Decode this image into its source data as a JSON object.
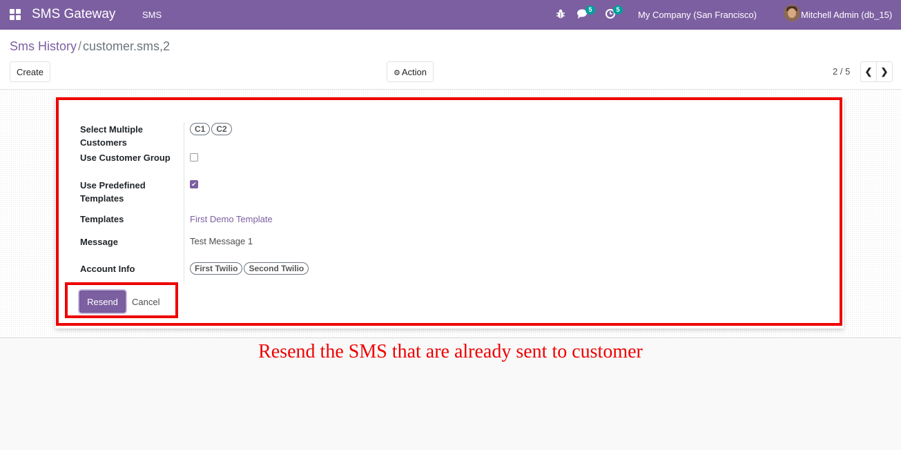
{
  "navbar": {
    "app_name": "SMS Gateway",
    "menu_item": "SMS",
    "chat_badge": "5",
    "activity_badge": "5",
    "company": "My Company (San Francisco)",
    "user": "Mitchell Admin (db_15)"
  },
  "control": {
    "breadcrumb_parent": "Sms History",
    "breadcrumb_separator": "/",
    "breadcrumb_current": "customer.sms,2",
    "create_label": "Create",
    "action_label": "Action",
    "pager": "2 / 5"
  },
  "form": {
    "fields": {
      "multiple_customers_label": "Select Multiple Customers",
      "customers": [
        "C1",
        "C2"
      ],
      "customer_group_label": "Use Customer Group",
      "customer_group_checked": false,
      "predefined_label": "Use Predefined Templates",
      "predefined_checked": true,
      "templates_label": "Templates",
      "template_value": "First Demo Template",
      "message_label": "Message",
      "message_value": "Test Message 1",
      "account_label": "Account Info",
      "accounts": [
        "First Twilio",
        "Second Twilio"
      ]
    },
    "resend_label": "Resend",
    "cancel_label": "Cancel"
  },
  "annotation": "Resend the SMS that are already sent to customer",
  "colors": {
    "brand": "#7c5fa1",
    "highlight": "#ee0000",
    "badge": "#00a09d"
  }
}
